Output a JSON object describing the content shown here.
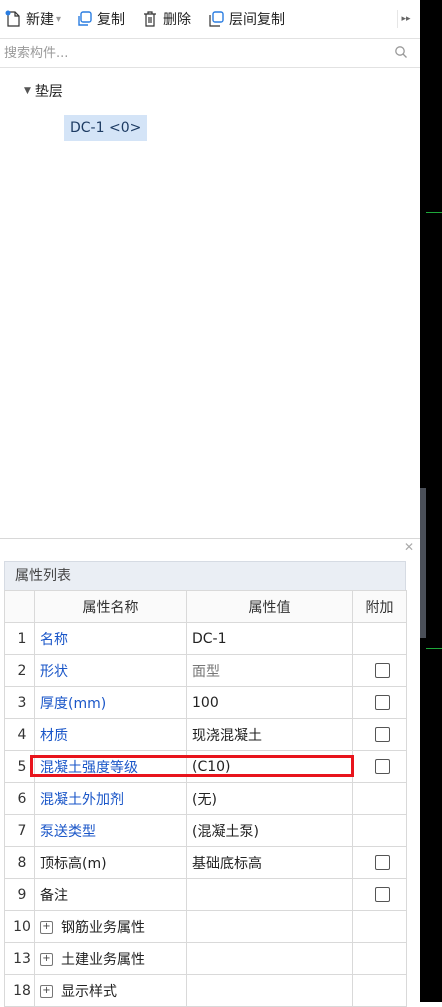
{
  "toolbar": {
    "new_label": "新建",
    "copy_label": "复制",
    "delete_label": "删除",
    "floor_copy_label": "层间复制",
    "more": "▸▸"
  },
  "search": {
    "placeholder": "搜索构件..."
  },
  "tree": {
    "parent_label": "垫层",
    "child_label": "DC-1 <0>"
  },
  "properties": {
    "title": "属性列表",
    "columns": [
      "属性名称",
      "属性值",
      "附加"
    ],
    "rows": [
      {
        "no": "1",
        "name": "名称",
        "value": "DC-1",
        "checkbox": false
      },
      {
        "no": "2",
        "name": "形状",
        "value": "面型",
        "checkbox": true
      },
      {
        "no": "3",
        "name": "厚度(mm)",
        "value": "100",
        "checkbox": true
      },
      {
        "no": "4",
        "name": "材质",
        "value": "现浇混凝土",
        "checkbox": true
      },
      {
        "no": "5",
        "name": "混凝土强度等级",
        "value": "(C10)",
        "checkbox": true
      },
      {
        "no": "6",
        "name": "混凝土外加剂",
        "value": "(无)",
        "checkbox": false
      },
      {
        "no": "7",
        "name": "泵送类型",
        "value": "(混凝土泵)",
        "checkbox": false
      },
      {
        "no": "8",
        "name": "顶标高(m)",
        "value": "基础底标高",
        "checkbox": true
      },
      {
        "no": "9",
        "name": "备注",
        "value": "",
        "checkbox": true
      },
      {
        "no": "10",
        "name": "钢筋业务属性",
        "value": "",
        "checkbox": false
      },
      {
        "no": "13",
        "name": "土建业务属性",
        "value": "",
        "checkbox": false
      },
      {
        "no": "18",
        "name": "显示样式",
        "value": "",
        "checkbox": false
      }
    ]
  },
  "colors": {
    "highlight": "#e8141c",
    "link": "#1a56c8",
    "selection": "#d4e4f7"
  }
}
